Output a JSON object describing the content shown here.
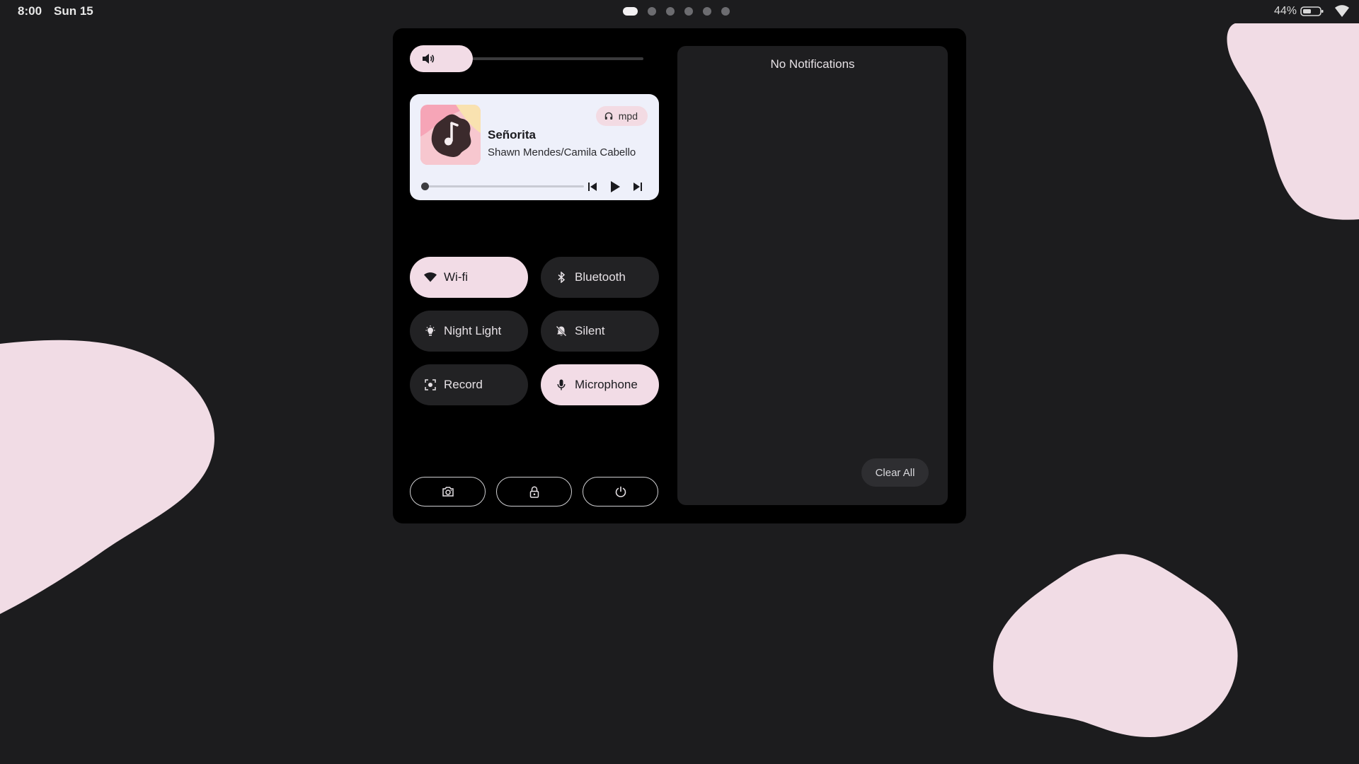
{
  "status_bar": {
    "time": "8:00",
    "date": "Sun 15",
    "workspaces": [
      {
        "active": true
      },
      {
        "active": false
      },
      {
        "active": false
      },
      {
        "active": false
      },
      {
        "active": false
      },
      {
        "active": false
      }
    ],
    "battery_percent": "44%",
    "battery_icon": "battery-icon",
    "wifi_icon": "wifi-icon"
  },
  "volume": {
    "icon": "volume-icon",
    "level": 0.1
  },
  "media": {
    "player": "mpd",
    "player_icon": "headphones-icon",
    "title": "Señorita",
    "artist": "Shawn Mendes/Camila Cabello",
    "progress": 0.0,
    "controls": [
      "previous-icon",
      "play-icon",
      "next-icon"
    ]
  },
  "toggles": [
    {
      "label": "Wi-fi",
      "icon": "wifi-icon",
      "on": true
    },
    {
      "label": "Bluetooth",
      "icon": "bluetooth-icon",
      "on": false
    },
    {
      "label": "Night Light",
      "icon": "night-light-icon",
      "on": false
    },
    {
      "label": "Silent",
      "icon": "bell-off-icon",
      "on": false
    },
    {
      "label": "Record",
      "icon": "screen-record-icon",
      "on": false
    },
    {
      "label": "Microphone",
      "icon": "microphone-icon",
      "on": true
    }
  ],
  "actions": [
    "screenshot-icon",
    "lock-icon",
    "power-icon"
  ],
  "notifications": {
    "empty_text": "No Notifications",
    "clear_label": "Clear All"
  },
  "colors": {
    "background": "#1c1c1e",
    "accent": "#f2dce6",
    "panel": "#000000",
    "media_card": "#eef0fa"
  }
}
